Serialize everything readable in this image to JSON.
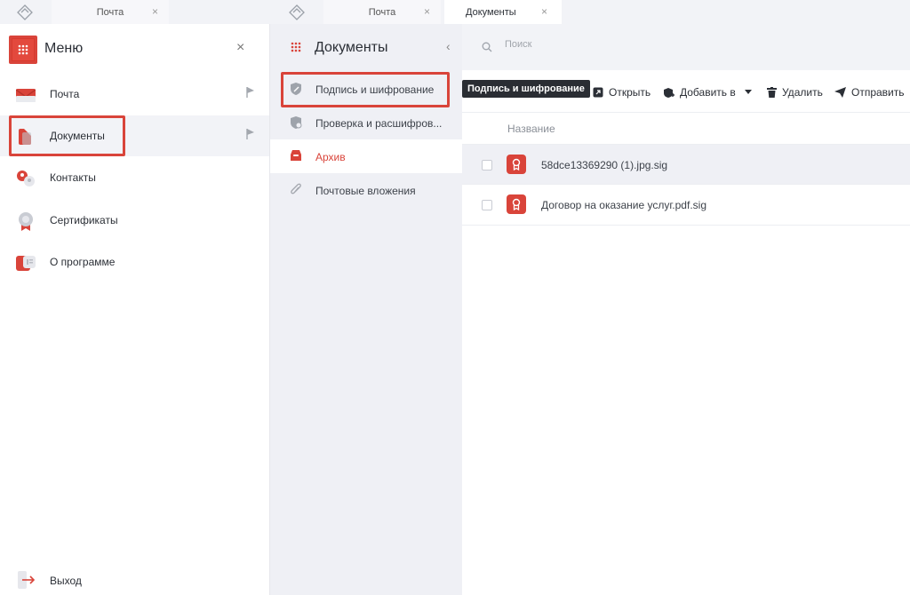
{
  "tabs_left": {
    "tab_label": "Почта",
    "close": "×"
  },
  "tabs_right": [
    {
      "label": "Почта",
      "close": "×",
      "active": false
    },
    {
      "label": "Документы",
      "close": "×",
      "active": true
    }
  ],
  "menu": {
    "title": "Меню",
    "close": "×",
    "items": [
      {
        "label": "Почта",
        "icon": "mail-icon",
        "flag": true
      },
      {
        "label": "Документы",
        "icon": "documents-icon",
        "flag": true,
        "selected": true
      },
      {
        "label": "Контакты",
        "icon": "contacts-icon",
        "flag": false
      },
      {
        "label": "Сертификаты",
        "icon": "certificate-icon",
        "flag": false
      },
      {
        "label": "О программе",
        "icon": "about-icon",
        "flag": false
      }
    ],
    "exit_label": "Выход"
  },
  "docs_nav": {
    "title": "Документы",
    "collapse": "‹",
    "items": [
      {
        "label": "Подпись и шифрование",
        "icon": "shield-sign-icon"
      },
      {
        "label": "Проверка и расшифров...",
        "icon": "shield-check-icon"
      },
      {
        "label": "Архив",
        "icon": "archive-icon",
        "selected": true
      },
      {
        "label": "Почтовые вложения",
        "icon": "paperclip-icon"
      }
    ]
  },
  "search": {
    "placeholder": "Поиск"
  },
  "toolbar": {
    "tooltip": "Подпись и шифрование",
    "open_label": "Открыть",
    "add_to_label": "Добавить в",
    "delete_label": "Удалить",
    "send_label": "Отправить"
  },
  "table": {
    "column_name": "Название",
    "rows": [
      {
        "name": "58dce13369290 (1).jpg.sig"
      },
      {
        "name": "Договор на оказание услуг.pdf.sig"
      }
    ]
  },
  "colors": {
    "accent": "#d9443a",
    "panel_bg": "#eff0f5",
    "tooltip_bg": "#2a2d33"
  }
}
